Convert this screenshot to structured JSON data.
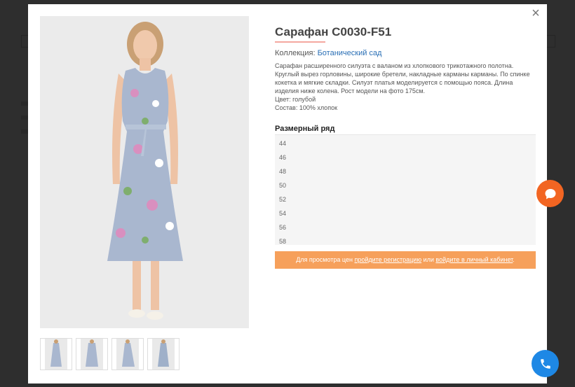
{
  "product": {
    "title": "Сарафан C0030-F51",
    "collection_label": "Коллекция:",
    "collection_value": "Ботанический сад",
    "description": "Сарафан расширенного силуэта с валаном из хлопкового трикотажного полотна. Круглый вырез горловины, широкие бретели, накладные карманы карманы. По спинке кокетка и мягкие складки. Силуэт платья моделируется с помощью пояса. Длина изделия ниже колена. Рост модели на фото 175см.",
    "color": "Цвет: голубой",
    "composition": "Состав: 100% хлопок"
  },
  "sizes": {
    "title": "Размерный ряд",
    "items": [
      "44",
      "46",
      "48",
      "50",
      "52",
      "54",
      "56",
      "58"
    ]
  },
  "price_notice": {
    "prefix": "Для просмотра цен",
    "link1": "пройдите регистрацию",
    "middle": "или",
    "link2": "войдите в личный кабинет",
    "suffix": "."
  },
  "icons": {
    "close": "close-icon",
    "chat": "chat-icon",
    "phone": "phone-icon"
  },
  "colors": {
    "accent_orange": "#f6a05b",
    "chat_orange": "#f26522",
    "call_blue": "#1e88e5",
    "link_blue": "#2a6fb5"
  }
}
